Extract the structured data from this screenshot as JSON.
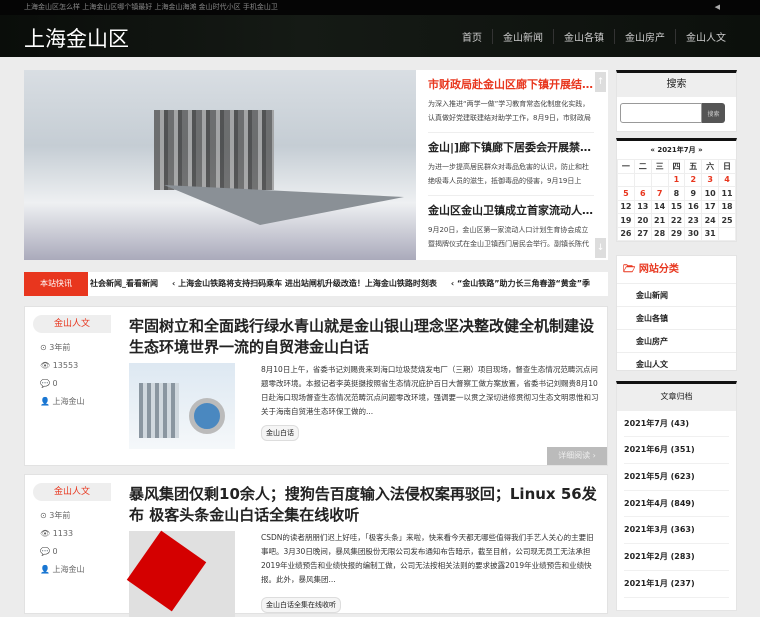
{
  "topbar": {
    "links": "上海金山区怎么样 上海金山区哪个镇最好 上海金山海滩 金山时代小区 手机金山卫",
    "speaker": "◀"
  },
  "header": {
    "logo": "上海金山区",
    "nav": [
      "首页",
      "金山新闻",
      "金山各镇",
      "金山房产",
      "金山人文"
    ]
  },
  "slider": {
    "items": [
      {
        "title": "市财政局赴金山区廊下镇开展结对帮扶",
        "excerpt": "为深入推进“两学一做”学习教育常态化制度化实践，认真做好党建联建结对助学工作，8月9日，市财政局"
      },
      {
        "title": "金山|]廊下镇廊下居委会开展禁毒宣传",
        "excerpt": "为进一步提高居民群众对毒品危害的认识，防止和杜绝吸毒人员的滋生，抵御毒品的侵害，9月19日上"
      },
      {
        "title": "金山区金山卫镇成立首家流动人口计生协会",
        "excerpt": "9月20日，金山区第一家流动人口计划生育协会成立暨揭牌仪式在金山卫镇西门居民会举行。副镇长陈代"
      }
    ],
    "up": "↑",
    "down": "↓"
  },
  "ticker": {
    "label": "本站快讯",
    "items": [
      "社会新闻_看看新闻",
      "‹ 上海金山铁路将支持扫码乘车 进出站闸机升级改造！上海金山铁路时刻表",
      "‹ “金山铁路”助力长三角春游“黄金”季"
    ]
  },
  "articles": [
    {
      "category": "金山人文",
      "time": "3年前",
      "views": "13553",
      "comments": "0",
      "author": "上海金山",
      "title": "牢固树立和全面践行绿水青山就是金山银山理念坚决整改健全机制建设生态环境世界一流的自贸港金山白话",
      "excerpt": "8月10日上午，省委书记刘赐贵来到海口垃圾焚烧发电厂（三期）项目现场，督查生态情况范畴沉点问题零改环境。本报记者李英挺摄按照省生态情况庇护百日大督察工做方案放置，省委书记刘赐贵8月10日赴海口现场督查生态情况范畴沉点问题零改环境，强调要一以贯之深切进修贯彻习生态文明思惟和习关于海南自贸港生态环保工做的...",
      "tag": "金山白话",
      "more": "详细阅读 ›"
    },
    {
      "category": "金山人文",
      "time": "3年前",
      "views": "1133",
      "comments": "0",
      "author": "上海金山",
      "title": "暴风集团仅剩10余人；搜狗告百度输入法侵权案再驳回；Linux 56发布 极客头条金山白话全集在线收听",
      "excerpt": "CSDN的读者朋朋们迟上好哇，「极客头条」来啦，快来看今天都无哪些值得我们手艺人关心的主要旧事吧。3月30日晚间，暴风集团股份无限公司发布通知布告暗示，截至目前，公司现无员工无法承担2019年业绩预告和业绩快报的编制工做，公司无法按相关法则的要求披露2019年业绩预告和业绩快报。此外，暴风集团...",
      "tag": "金山白话全集在线收听"
    }
  ],
  "sidebar": {
    "search": {
      "title": "搜索",
      "button": "搜索",
      "placeholder": ""
    },
    "calendar": {
      "title": "« 2021年7月 »",
      "weekdays": [
        "一",
        "二",
        "三",
        "四",
        "五",
        "六",
        "日"
      ],
      "red_days": [
        1,
        2,
        3,
        4,
        5,
        6,
        7
      ]
    },
    "categories": {
      "title": "网站分类",
      "items": [
        "金山新闻",
        "金山各镇",
        "金山房产",
        "金山人文"
      ]
    },
    "archive": {
      "title": "文章归档",
      "items": [
        "2021年7月 (43)",
        "2021年6月 (351)",
        "2021年5月 (623)",
        "2021年4月 (849)",
        "2021年3月 (363)",
        "2021年2月 (283)",
        "2021年1月 (237)"
      ]
    }
  },
  "colors": {
    "accent": "#e8361e"
  }
}
